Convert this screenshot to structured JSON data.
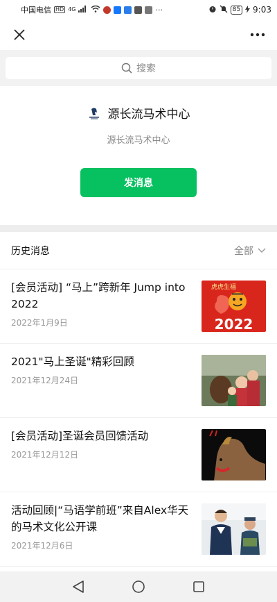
{
  "status_bar": {
    "carrier": "中国电信",
    "hd": "HD",
    "network": "4G",
    "more": "···",
    "battery": "85",
    "time": "9:03"
  },
  "topbar": {
    "close_icon": "close-icon",
    "more_icon": "more-icon"
  },
  "search": {
    "placeholder": "搜索",
    "icon": "search-icon"
  },
  "profile": {
    "name": "源长流马术中心",
    "subtitle": "源长流马术中心",
    "send_button": "发消息"
  },
  "history": {
    "title": "历史消息",
    "filter": "全部",
    "items": [
      {
        "title": "[会员活动] “马上”跨新年 Jump into 2022",
        "date": "2022年1月9日",
        "thumb_text": "2022",
        "thumb_top_text": "虎虎生福"
      },
      {
        "title": "2021\"马上圣诞\"精彩回顾",
        "date": "2021年12月24日"
      },
      {
        "title": "[会员活动]圣诞会员回馈活动",
        "date": "2021年12月12日"
      },
      {
        "title": "活动回顾|“马语学前班”来自Alex华天的马术文化公开课",
        "date": "2021年12月6日"
      }
    ]
  },
  "colors": {
    "accent": "#07c160",
    "background_gray": "#ededed",
    "muted_text": "#888888"
  }
}
